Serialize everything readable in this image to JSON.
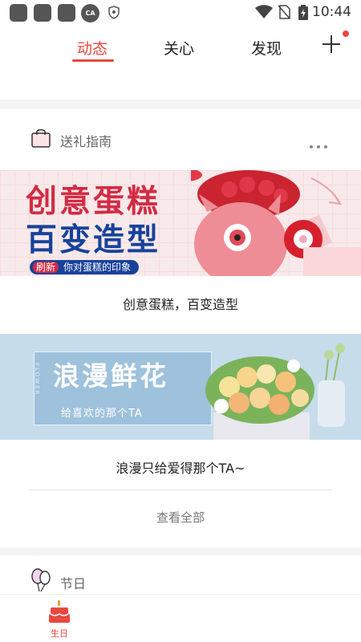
{
  "status_bar": {
    "time": "10:44",
    "app_badge": "CA"
  },
  "top_nav": {
    "tabs": [
      {
        "label": "动态",
        "active": true
      },
      {
        "label": "关心",
        "active": false
      },
      {
        "label": "发现",
        "active": false
      }
    ],
    "add_button": "+",
    "accent_color": "#e8483f"
  },
  "gift_guide": {
    "title": "送礼指南",
    "banners": [
      {
        "line1": "创意蛋糕",
        "line2": "百变造型",
        "badge_highlight": "刷新",
        "badge_text": "你对蛋糕的印象",
        "caption": "创意蛋糕，百变造型"
      },
      {
        "line1": "浪漫鲜花",
        "line2": "给喜欢的那个TA",
        "vertical_text": "FLOWER",
        "caption": "浪漫只给爱得那个TA~"
      }
    ],
    "view_all": "查看全部"
  },
  "holiday_section": {
    "title": "节日"
  },
  "bottom_nav": {
    "items": [
      {
        "label": "生日",
        "icon": "cake-icon",
        "active": true
      }
    ]
  },
  "colors": {
    "accent": "#e8483f",
    "banner1_red": "#d32b44",
    "banner1_blue": "#17429b",
    "banner2_bg": "#c6dceb"
  }
}
